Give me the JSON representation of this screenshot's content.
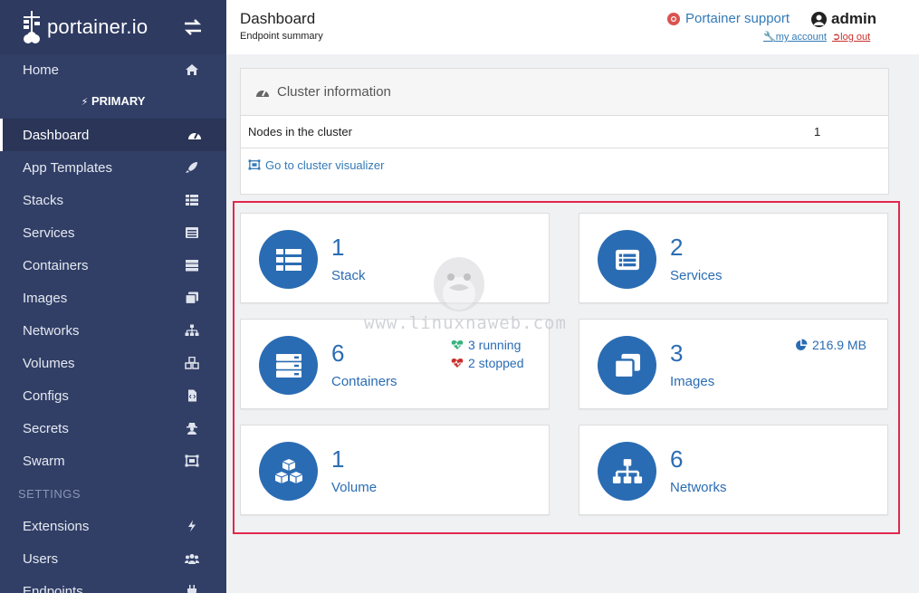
{
  "brand": {
    "name": "portainer.io"
  },
  "sidebar": {
    "home": "Home",
    "endpoint": "PRIMARY",
    "items": [
      {
        "label": "Dashboard",
        "icon": "tachometer-icon"
      },
      {
        "label": "App Templates",
        "icon": "rocket-icon"
      },
      {
        "label": "Stacks",
        "icon": "th-list-icon"
      },
      {
        "label": "Services",
        "icon": "list-alt-icon"
      },
      {
        "label": "Containers",
        "icon": "server-icon"
      },
      {
        "label": "Images",
        "icon": "clone-icon"
      },
      {
        "label": "Networks",
        "icon": "sitemap-icon"
      },
      {
        "label": "Volumes",
        "icon": "cubes-icon"
      },
      {
        "label": "Configs",
        "icon": "file-code-icon"
      },
      {
        "label": "Secrets",
        "icon": "user-secret-icon"
      },
      {
        "label": "Swarm",
        "icon": "object-group-icon"
      }
    ],
    "settings_label": "SETTINGS",
    "settings_items": [
      {
        "label": "Extensions",
        "icon": "bolt-icon"
      },
      {
        "label": "Users",
        "icon": "users-icon"
      },
      {
        "label": "Endpoints",
        "icon": "plug-icon"
      }
    ]
  },
  "header": {
    "title": "Dashboard",
    "subtitle": "Endpoint summary",
    "support": "Portainer support",
    "user": "admin",
    "my_account": "my account",
    "log_out": "log out"
  },
  "cluster": {
    "title": "Cluster information",
    "nodes_label": "Nodes in the cluster",
    "nodes_value": "1",
    "visualizer_link": "Go to cluster visualizer"
  },
  "tiles": {
    "stack": {
      "value": "1",
      "label": "Stack"
    },
    "services": {
      "value": "2",
      "label": "Services"
    },
    "containers": {
      "value": "6",
      "label": "Containers",
      "running": "3 running",
      "stopped": "2 stopped"
    },
    "images": {
      "value": "3",
      "label": "Images",
      "size": "216.9 MB"
    },
    "volume": {
      "value": "1",
      "label": "Volume"
    },
    "networks": {
      "value": "6",
      "label": "Networks"
    }
  },
  "watermark": "www.linuxnaweb.com",
  "colors": {
    "sidebar": "#313f67",
    "accent": "#2a6cb3",
    "highlight": "#e2284c",
    "running": "#36b37e",
    "stopped": "#c9302c"
  }
}
